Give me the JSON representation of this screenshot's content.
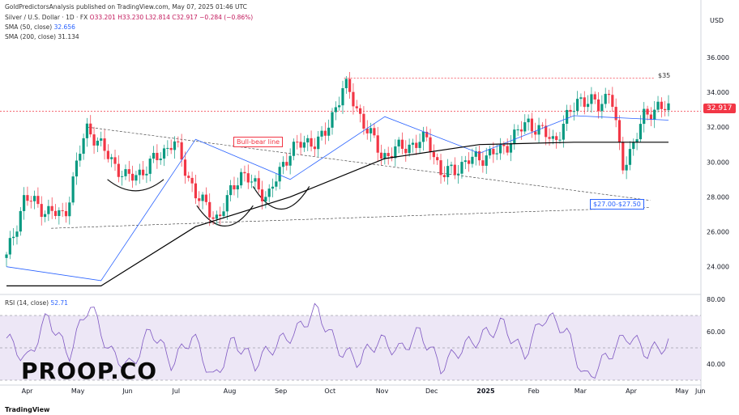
{
  "header": {
    "publisher": "GoldPredictorsAnalysis published on TradingView.com, May 07, 2025 01:46 UTC",
    "symbol": "Silver / U.S. Dollar · 1D · FX",
    "ohlc": "O33.201 H33.230 L32.814 C32.917 −0.284 (−0.86%)",
    "sma50_label": "SMA (50, close)",
    "sma50_value": "32.656",
    "sma200_label": "SMA (200, close)",
    "sma200_value": "31.134"
  },
  "currency": "USD",
  "last_price": "32.917",
  "annotations": {
    "target": "$35",
    "bull_bear": "Bull-bear line",
    "support": "$27.00-$27.50"
  },
  "rsi": {
    "label": "RSI (14, close)",
    "value": "52.71"
  },
  "brand": "PROOP.CO",
  "footer": "TradingView",
  "colors": {
    "up": "#089981",
    "down": "#f23645",
    "sma50": "#2962ff",
    "sma200": "#000000",
    "rsi": "#7e57c2",
    "rsi_band": "#ede7f6"
  },
  "chart_data": [
    {
      "type": "candlestick",
      "title": "Silver / U.S. Dollar · 1D · FX",
      "ylabel": "USD",
      "ylim": [
        22.5,
        37.2
      ],
      "y_ticks": [
        "36.000",
        "34.000",
        "32.000",
        "30.000",
        "28.000",
        "26.000",
        "24.000"
      ],
      "x_ticks": [
        "Apr",
        "May",
        "Jun",
        "Jul",
        "Aug",
        "Sep",
        "Oct",
        "Nov",
        "Dec",
        "2025",
        "Feb",
        "Mar",
        "Apr",
        "May",
        "Jun"
      ],
      "close_path": [
        [
          "2024-04-01",
          24.5
        ],
        [
          "2024-04-12",
          28.0
        ],
        [
          "2024-04-25",
          27.2
        ],
        [
          "2024-05-06",
          26.9
        ],
        [
          "2024-05-17",
          31.2
        ],
        [
          "2024-05-20",
          32.0
        ],
        [
          "2024-05-31",
          30.5
        ],
        [
          "2024-06-13",
          29.0
        ],
        [
          "2024-06-24",
          29.6
        ],
        [
          "2024-07-11",
          31.2
        ],
        [
          "2024-07-25",
          28.0
        ],
        [
          "2024-08-07",
          26.7
        ],
        [
          "2024-08-20",
          29.4
        ],
        [
          "2024-09-06",
          28.0
        ],
        [
          "2024-09-20",
          30.8
        ],
        [
          "2024-10-10",
          31.4
        ],
        [
          "2024-10-22",
          34.5
        ],
        [
          "2024-11-01",
          32.6
        ],
        [
          "2024-11-14",
          30.3
        ],
        [
          "2024-11-25",
          30.8
        ],
        [
          "2024-12-12",
          31.3
        ],
        [
          "2024-12-20",
          29.2
        ],
        [
          "2025-01-06",
          30.1
        ],
        [
          "2025-01-24",
          30.6
        ],
        [
          "2025-02-10",
          32.3
        ],
        [
          "2025-02-26",
          31.2
        ],
        [
          "2025-03-13",
          33.7
        ],
        [
          "2025-03-25",
          33.2
        ],
        [
          "2025-04-01",
          34.2
        ],
        [
          "2025-04-08",
          29.6
        ],
        [
          "2025-04-21",
          32.5
        ],
        [
          "2025-04-30",
          33.3
        ],
        [
          "2025-05-06",
          32.917
        ]
      ],
      "series": [
        {
          "name": "SMA (50, close)",
          "values": [
            [
              24.0,
              23.2
            ],
            [
              31.3,
              29.0
            ],
            [
              32.6,
              30.5
            ],
            [
              32.656,
              32.4
            ]
          ]
        },
        {
          "name": "SMA (200, close)",
          "values": [
            [
              22.9,
              22.9
            ],
            [
              26.3,
              28.0
            ],
            [
              30.2,
              31.0
            ],
            [
              31.134,
              31.134
            ]
          ]
        }
      ],
      "levels": [
        {
          "label": "$35",
          "value": 34.8
        },
        {
          "label": "32.917",
          "value": 32.917
        }
      ]
    },
    {
      "type": "line",
      "title": "RSI (14, close)",
      "ylim": [
        28,
        82
      ],
      "y_ticks": [
        "80.00",
        "60.00",
        "40.00"
      ],
      "band": [
        30,
        70
      ],
      "midline": 50,
      "values": [
        56,
        42,
        70,
        45,
        78,
        47,
        38,
        62,
        40,
        58,
        30,
        55,
        40,
        52,
        60,
        74,
        50,
        42,
        55,
        48,
        60,
        38,
        50,
        57,
        65,
        45,
        70,
        62,
        30,
        44,
        58,
        47,
        52.71
      ]
    }
  ]
}
